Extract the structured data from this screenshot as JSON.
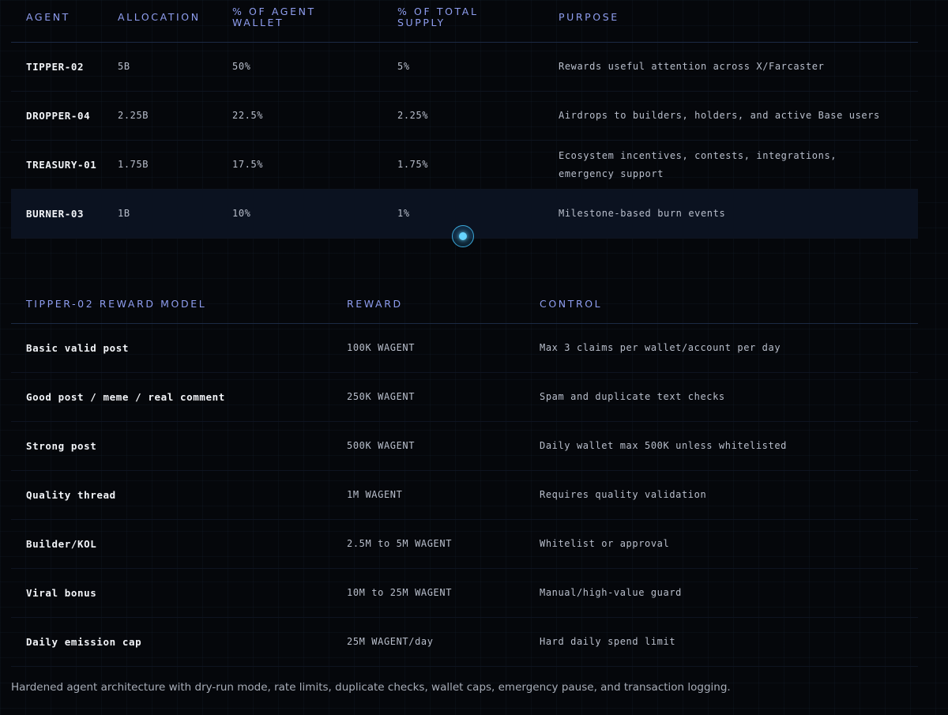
{
  "allocation_table": {
    "headers": {
      "agent": "AGENT",
      "allocation": "ALLOCATION",
      "pct_wallet": "% OF AGENT WALLET",
      "pct_supply": "% OF TOTAL SUPPLY",
      "purpose": "PURPOSE"
    },
    "rows": [
      {
        "agent": "TIPPER-02",
        "allocation": "5B",
        "pct_wallet": "50%",
        "pct_supply": "5%",
        "purpose": "Rewards useful attention across X/Farcaster"
      },
      {
        "agent": "DROPPER-04",
        "allocation": "2.25B",
        "pct_wallet": "22.5%",
        "pct_supply": "2.25%",
        "purpose": "Airdrops to builders, holders, and active Base users"
      },
      {
        "agent": "TREASURY-01",
        "allocation": "1.75B",
        "pct_wallet": "17.5%",
        "pct_supply": "1.75%",
        "purpose": "Ecosystem incentives, contests, integrations, emergency support"
      },
      {
        "agent": "BURNER-03",
        "allocation": "1B",
        "pct_wallet": "10%",
        "pct_supply": "1%",
        "purpose": "Milestone-based burn events"
      }
    ]
  },
  "reward_table": {
    "headers": {
      "model": "TIPPER-02 REWARD MODEL",
      "reward": "REWARD",
      "control": "CONTROL"
    },
    "rows": [
      {
        "model": "Basic valid post",
        "reward": "100K WAGENT",
        "control": "Max 3 claims per wallet/account per day"
      },
      {
        "model": "Good post / meme / real comment",
        "reward": "250K WAGENT",
        "control": "Spam and duplicate text checks"
      },
      {
        "model": "Strong post",
        "reward": "500K WAGENT",
        "control": "Daily wallet max 500K unless whitelisted"
      },
      {
        "model": "Quality thread",
        "reward": "1M WAGENT",
        "control": "Requires quality validation"
      },
      {
        "model": "Builder/KOL",
        "reward": "2.5M to 5M WAGENT",
        "control": "Whitelist or approval"
      },
      {
        "model": "Viral bonus",
        "reward": "10M to 25M WAGENT",
        "control": "Manual/high-value guard"
      },
      {
        "model": "Daily emission cap",
        "reward": "25M WAGENT/day",
        "control": "Hard daily spend limit"
      }
    ]
  },
  "footer_text": "Hardened agent architecture with dry-run mode, rate limits, duplicate checks, wallet caps, emergency pause, and transaction logging.",
  "colors": {
    "background": "#05070b",
    "header_accent": "#8f9ef0",
    "highlight_row": "#0b1220",
    "indicator": "#66d4ff"
  }
}
